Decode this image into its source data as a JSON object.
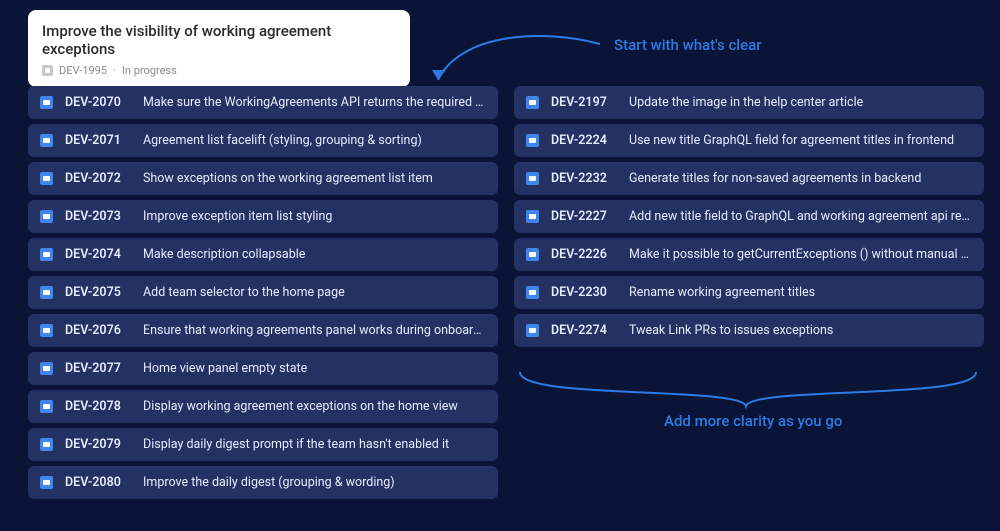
{
  "header": {
    "title": "Improve the visibility of working agreement exceptions",
    "id": "DEV-1995",
    "status": "In progress"
  },
  "annotations": {
    "top": "Start with what's clear",
    "bottom": "Add more clarity as you go"
  },
  "col1": [
    {
      "id": "DEV-2070",
      "title": "Make sure the WorkingAgreements API returns the required data"
    },
    {
      "id": "DEV-2071",
      "title": "Agreement list facelift (styling, grouping & sorting)"
    },
    {
      "id": "DEV-2072",
      "title": "Show exceptions on the working agreement list item"
    },
    {
      "id": "DEV-2073",
      "title": "Improve exception item list styling"
    },
    {
      "id": "DEV-2074",
      "title": "Make description collapsable"
    },
    {
      "id": "DEV-2075",
      "title": "Add team selector to the home page"
    },
    {
      "id": "DEV-2076",
      "title": "Ensure that working agreements panel works during onboarding"
    },
    {
      "id": "DEV-2077",
      "title": "Home view panel empty state"
    },
    {
      "id": "DEV-2078",
      "title": "Display working agreement exceptions on the home view"
    },
    {
      "id": "DEV-2079",
      "title": "Display daily digest prompt if the team hasn't enabled it"
    },
    {
      "id": "DEV-2080",
      "title": "Improve the daily digest (grouping & wording)"
    }
  ],
  "col2": [
    {
      "id": "DEV-2197",
      "title": "Update the image in the help center article"
    },
    {
      "id": "DEV-2224",
      "title": "Use new title GraphQL field for agreement titles in frontend"
    },
    {
      "id": "DEV-2232",
      "title": "Generate titles for non-saved agreements in backend"
    },
    {
      "id": "DEV-2227",
      "title": "Add new title field to GraphQL and working agreement api retu.."
    },
    {
      "id": "DEV-2226",
      "title": "Make it possible to getCurrentExceptions () without manual config"
    },
    {
      "id": "DEV-2230",
      "title": "Rename working agreement titles"
    },
    {
      "id": "DEV-2274",
      "title": "Tweak Link PRs to issues exceptions"
    }
  ]
}
